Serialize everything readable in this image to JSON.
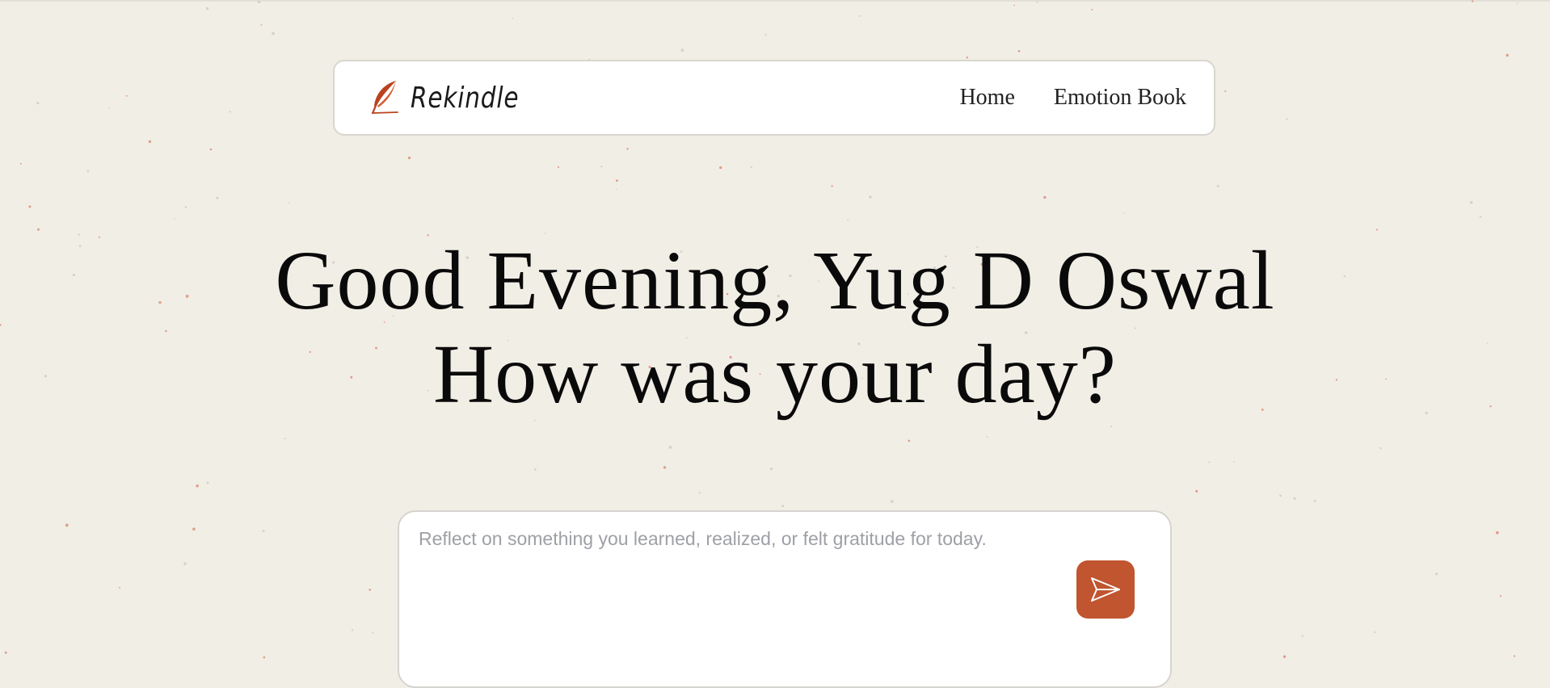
{
  "app": {
    "brand_name": "Rekindle",
    "logo_icon": "feather-icon"
  },
  "nav": {
    "items": [
      {
        "label": "Home"
      },
      {
        "label": "Emotion Book"
      }
    ]
  },
  "hero": {
    "greeting": "Good Evening, Yug D Oswal",
    "question": "How was your day?"
  },
  "composer": {
    "placeholder": "Reflect on something you learned, realized, or felt gratitude for today.",
    "value": "",
    "send_icon": "send-icon"
  },
  "colors": {
    "background": "#f1eee6",
    "accent": "#c0552f",
    "brand_feather": "#b9431f",
    "card": "#ffffff"
  }
}
